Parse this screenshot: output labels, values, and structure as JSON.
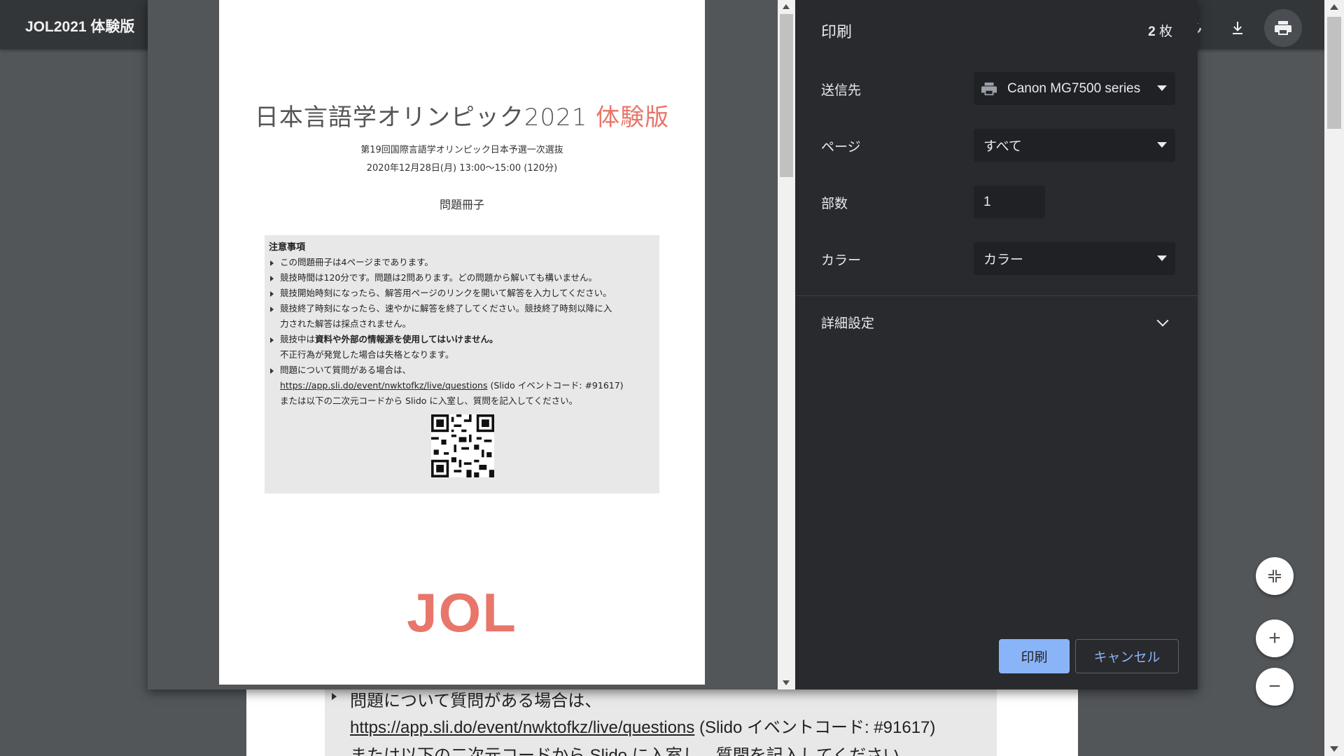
{
  "viewer": {
    "title": "JOL2021 体験版",
    "icons": [
      "rotate-icon",
      "download-icon",
      "print-icon"
    ],
    "background_text": {
      "line1": "問題について質問がある場合は、",
      "link": "https://app.sli.do/event/nwktofkz/live/questions",
      "line2_suffix": " (Slido イベントコード: #91617)",
      "line3": "または以下の二次元コードから Slido に入室し、質問を記入してください。"
    },
    "zoom_controls": {
      "fit": "⤡",
      "zoom_in": "+",
      "zoom_out": "−"
    }
  },
  "preview": {
    "title_main": "日本言語学オリンピック2021 ",
    "title_accent": "体験版",
    "subtitle1": "第19回国際言語学オリンピック日本予選一次選抜",
    "subtitle2": "2020年12月28日(月) 13:00〜15:00 (120分)",
    "booklet": "問題冊子",
    "notice": {
      "heading": "注意事項",
      "item1": "この問題冊子は4ページまであります。",
      "item2": "競技時間は120分です。問題は2問あります。どの問題から解いても構いません。",
      "item3": "競技開始時刻になったら、解答用ページのリンクを開いて解答を入力してください。",
      "item4a": "競技終了時刻になったら、速やかに解答を終了してください。競技終了時刻以降に入",
      "item4b": "力された解答は採点されません。",
      "item5_prefix": "競技中は",
      "item5_bold": "資料や外部の情報源を使用してはいけません。",
      "item5b": "不正行為が発覚した場合は失格となります。",
      "item6": "問題について質問がある場合は、",
      "item6_link": "https://app.sli.do/event/nwktofkz/live/questions",
      "item6_suffix": " (Slido イベントコード: #91617)",
      "item6b": "または以下の二次元コードから Slido に入室し、質問を記入してください。"
    },
    "logo": "JOL"
  },
  "print": {
    "title": "印刷",
    "sheet_count": "2",
    "sheet_unit": " 枚",
    "destination_label": "送信先",
    "destination_value": "Canon MG7500 series",
    "pages_label": "ページ",
    "pages_value": "すべて",
    "copies_label": "部数",
    "copies_value": "1",
    "color_label": "カラー",
    "color_value": "カラー",
    "advanced_label": "詳細設定",
    "print_button": "印刷",
    "cancel_button": "キャンセル"
  },
  "colors": {
    "accent": "#e8766a",
    "print_button": "#8ab4f8",
    "panel": "#292a2d"
  }
}
